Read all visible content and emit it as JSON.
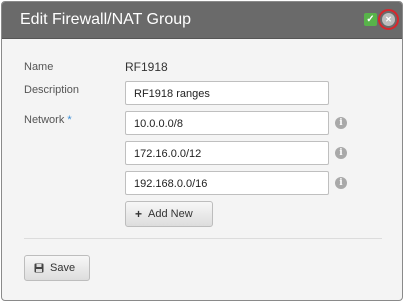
{
  "dialog": {
    "title": "Edit Firewall/NAT Group",
    "ok_symbol": "✓",
    "close_symbol": "✕"
  },
  "form": {
    "name_label": "Name",
    "name_value": "RF1918",
    "description_label": "Description",
    "description_value": "RF1918 ranges",
    "network_label": "Network",
    "required_marker": "*",
    "networks": [
      "10.0.0.0/8",
      "172.16.0.0/12",
      "192.168.0.0/16"
    ],
    "info_symbol": "i",
    "add_new_label": "Add New",
    "add_new_symbol": "+",
    "save_label": "Save"
  },
  "colors": {
    "titlebar": "#6a6a6a",
    "ok_button": "#58b34a",
    "close_highlight": "#d9262c",
    "required_marker": "#3b8ed6"
  },
  "icons": {
    "ok": "check-icon",
    "close": "close-icon",
    "info": "info-icon",
    "add": "plus-icon",
    "save": "floppy-disk-icon"
  }
}
